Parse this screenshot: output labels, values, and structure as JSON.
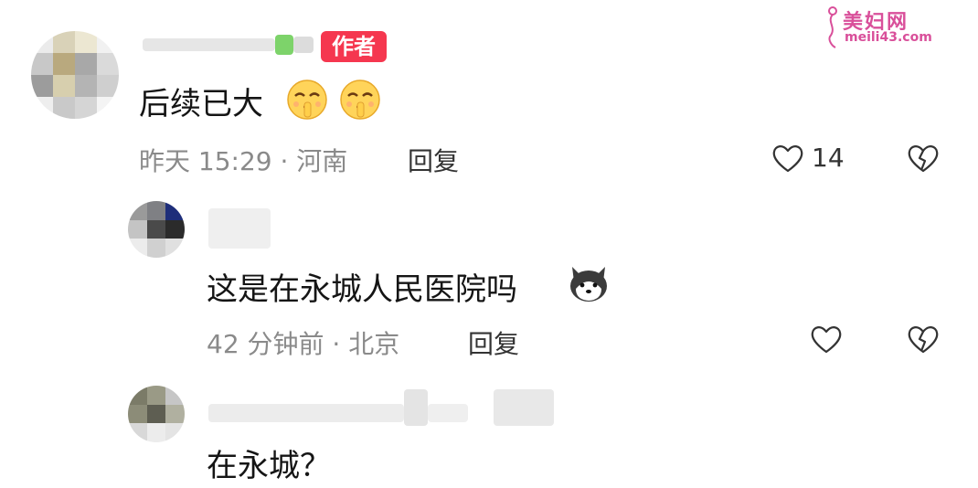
{
  "watermark": {
    "title": "美妇网",
    "url": "meili43.com",
    "logo": "woman-silhouette-icon"
  },
  "comments": [
    {
      "author_badge": "作者",
      "text": "后续已大",
      "emojis": [
        "shushing-face-emoji",
        "shushing-face-emoji"
      ],
      "meta": "昨天 15:29 · 河南",
      "reply_label": "回复",
      "likes": "14",
      "like_icon": "heart-icon",
      "dislike_icon": "broken-heart-icon"
    },
    {
      "text": "这是在永城人民医院吗",
      "emojis": [
        "husky-dog-emoji"
      ],
      "meta": "42 分钟前 · 北京",
      "reply_label": "回复",
      "like_icon": "heart-icon",
      "dislike_icon": "broken-heart-icon"
    },
    {
      "text": "在永城？"
    }
  ],
  "colors": {
    "author_tag": "#f5374f",
    "meta_text": "#8a8a8a",
    "watermark": "#d94f9a"
  }
}
